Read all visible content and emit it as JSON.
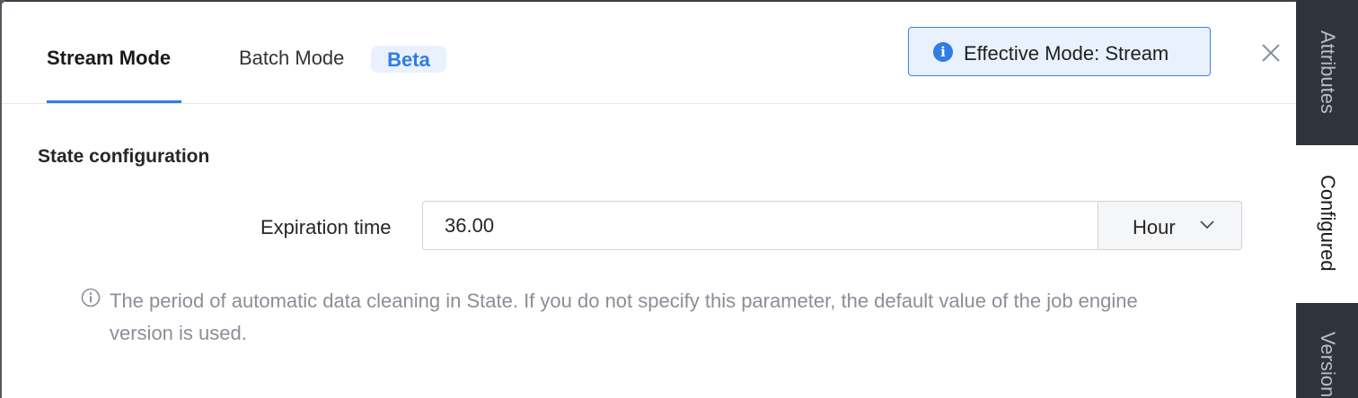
{
  "tabs": [
    {
      "label": "Stream Mode",
      "active": true
    },
    {
      "label": "Batch Mode",
      "active": false,
      "badge": "Beta"
    }
  ],
  "mode_info": {
    "icon": "info-icon",
    "text": "Effective Mode: Stream"
  },
  "close": {
    "icon": "close-icon"
  },
  "section": {
    "title": "State configuration"
  },
  "expiration": {
    "label": "Expiration time",
    "value": "36.00",
    "unit": "Hour"
  },
  "help": {
    "icon": "help-icon",
    "text": "The period of automatic data cleaning in State. If you do not specify this parameter, the default value of the job engine version is used."
  },
  "side_tabs": [
    {
      "label": "Attributes",
      "active": false
    },
    {
      "label": "Configured",
      "active": true
    },
    {
      "label": "Versions",
      "active": false
    }
  ],
  "colors": {
    "accent": "#2f7de1",
    "info_background": "#e8f1fd",
    "rail": "#2f333b"
  }
}
